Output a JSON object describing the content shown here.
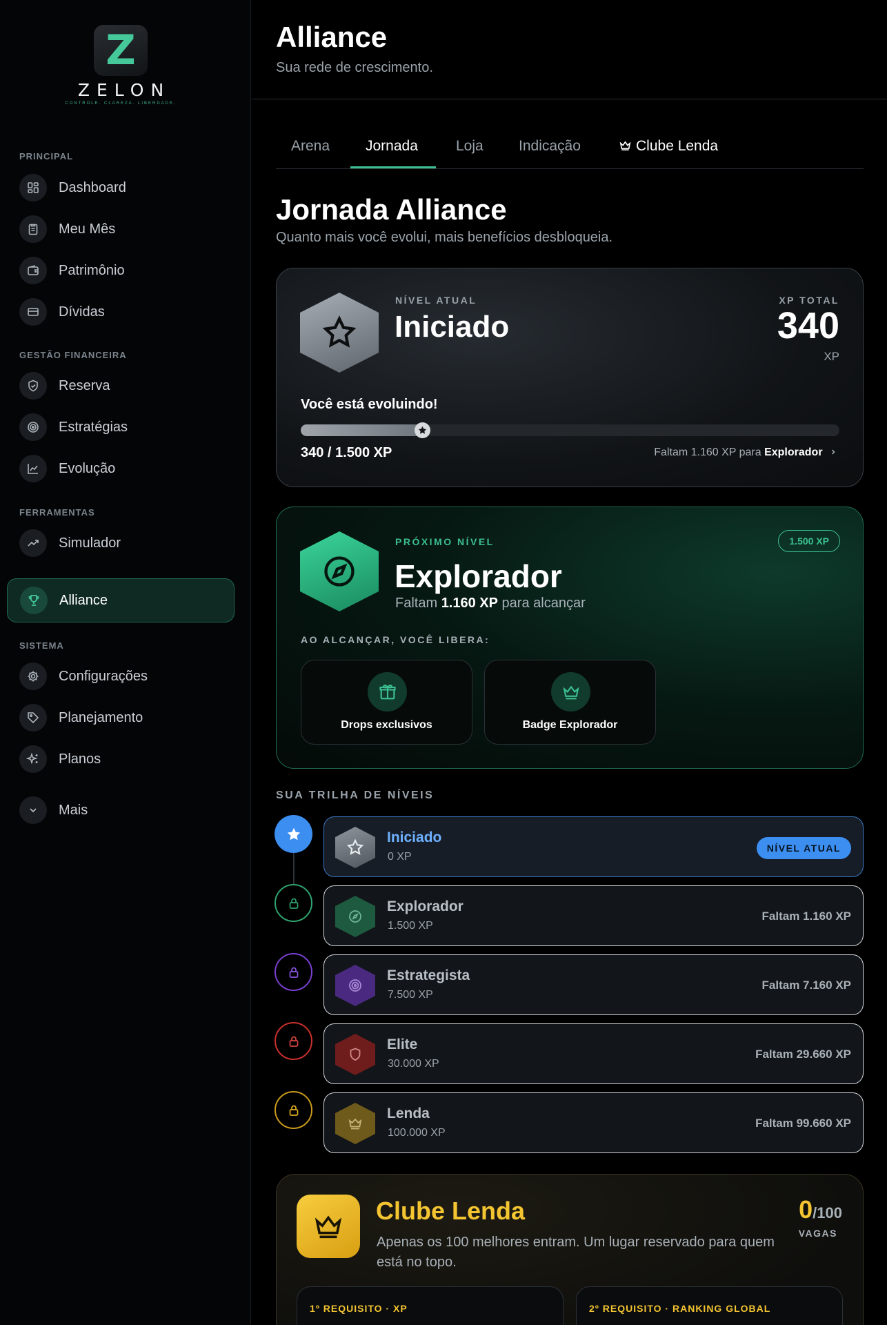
{
  "brand": {
    "letter": "Z",
    "name": "ZELON",
    "tagline": "CONTROLE. CLAREZA. LIBERDADE."
  },
  "sidebar": {
    "sections": [
      {
        "title": "PRINCIPAL",
        "items": [
          {
            "label": "Dashboard",
            "icon": "grid-icon"
          },
          {
            "label": "Meu Mês",
            "icon": "clipboard-icon"
          },
          {
            "label": "Patrimônio",
            "icon": "wallet-icon"
          },
          {
            "label": "Dívidas",
            "icon": "credit-card-icon"
          }
        ]
      },
      {
        "title": "GESTÃO FINANCEIRA",
        "items": [
          {
            "label": "Reserva",
            "icon": "shield-icon"
          },
          {
            "label": "Estratégias",
            "icon": "target-icon"
          },
          {
            "label": "Evolução",
            "icon": "chart-line-icon"
          }
        ]
      },
      {
        "title": "FERRAMENTAS",
        "items": [
          {
            "label": "Simulador",
            "icon": "trend-up-icon"
          }
        ]
      },
      {
        "title": "SISTEMA",
        "items": [
          {
            "label": "Configurações",
            "icon": "gear-icon"
          },
          {
            "label": "Planejamento",
            "icon": "tag-icon"
          },
          {
            "label": "Planos",
            "icon": "sparkles-icon"
          }
        ]
      }
    ],
    "active": {
      "label": "Alliance",
      "icon": "trophy-icon"
    },
    "more": {
      "label": "Mais",
      "icon": "chevron-down-icon"
    }
  },
  "header": {
    "title": "Alliance",
    "subtitle": "Sua rede de crescimento."
  },
  "tabs": [
    {
      "label": "Arena"
    },
    {
      "label": "Jornada",
      "active": true
    },
    {
      "label": "Loja"
    },
    {
      "label": "Indicação"
    },
    {
      "label": "Clube Lenda",
      "icon": "crown-icon"
    }
  ],
  "journey": {
    "title": "Jornada Alliance",
    "subtitle": "Quanto mais você evolui, mais benefícios desbloqueia."
  },
  "current_level": {
    "label": "NÍVEL ATUAL",
    "name": "Iniciado",
    "xp_total_label": "XP TOTAL",
    "xp_total": "340",
    "xp_unit": "XP",
    "message": "Você está evoluindo!",
    "progress_text": "340 / 1.500 XP",
    "progress_fraction": 0.227,
    "remaining_prefix": "Faltam 1.160 XP para",
    "remaining_target": "Explorador"
  },
  "next_level": {
    "label": "PRÓXIMO NÍVEL",
    "name": "Explorador",
    "pill": "1.500 XP",
    "sub_prefix": "Faltam",
    "sub_amount": "1.160 XP",
    "sub_suffix": "para alcançar",
    "unlock_label": "AO ALCANÇAR, VOCÊ LIBERA:",
    "perks": [
      {
        "label": "Drops exclusivos",
        "icon": "gift-icon"
      },
      {
        "label": "Badge Explorador",
        "icon": "crown-icon"
      }
    ]
  },
  "trail": {
    "title": "SUA TRILHA DE NÍVEIS",
    "levels": [
      {
        "name": "Iniciado",
        "xp": "0 XP",
        "status": "NÍVEL ATUAL",
        "color": "#3c8ef0",
        "icon": "star-icon"
      },
      {
        "name": "Explorador",
        "xp": "1.500 XP",
        "status": "Faltam 1.160 XP",
        "color": "#2fa36f",
        "icon": "compass-icon"
      },
      {
        "name": "Estrategista",
        "xp": "7.500 XP",
        "status": "Faltam 7.160 XP",
        "color": "#7a3fd1",
        "icon": "target-icon"
      },
      {
        "name": "Elite",
        "xp": "30.000 XP",
        "status": "Faltam 29.660 XP",
        "color": "#c9302c",
        "icon": "shield-icon"
      },
      {
        "name": "Lenda",
        "xp": "100.000 XP",
        "status": "Faltam 99.660 XP",
        "color": "#c99a1c",
        "icon": "crown-icon"
      }
    ]
  },
  "clube_lenda": {
    "title": "Clube Lenda",
    "description": "Apenas os 100 melhores entram. Um lugar reservado para quem está no topo.",
    "count": "0",
    "count_total": "/100",
    "count_label": "VAGAS",
    "requirements": [
      {
        "label": "1º REQUISITO · XP"
      },
      {
        "label": "2º REQUISITO · RANKING GLOBAL"
      }
    ]
  }
}
